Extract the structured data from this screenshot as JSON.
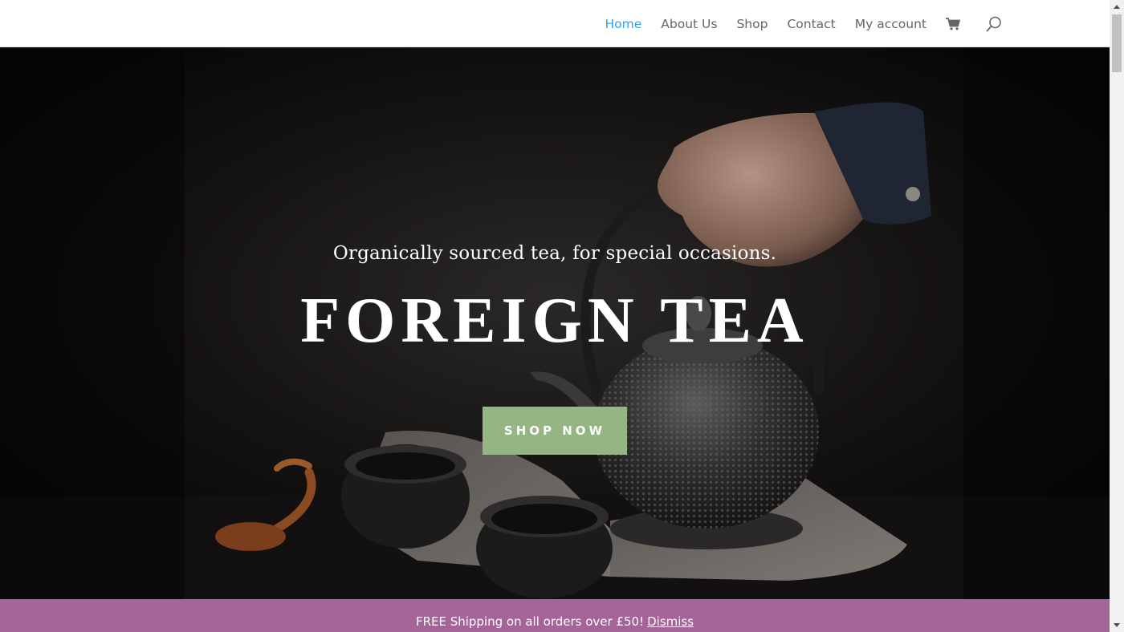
{
  "nav": {
    "items": [
      {
        "label": "Home",
        "active": true
      },
      {
        "label": "About Us",
        "active": false
      },
      {
        "label": "Shop",
        "active": false
      },
      {
        "label": "Contact",
        "active": false
      },
      {
        "label": "My account",
        "active": false
      }
    ],
    "cart_icon": "shopping-cart-icon",
    "search_icon": "search-icon"
  },
  "hero": {
    "subtitle": "Organically sourced tea, for special occasions.",
    "title": "FOREIGN TEA",
    "cta_label": "SHOP NOW"
  },
  "notice": {
    "text": "FREE Shipping on all orders over £50!",
    "dismiss_label": "Dismiss"
  },
  "colors": {
    "nav_active": "#2ea3f2",
    "nav_text": "#666666",
    "cta_background": "#96b585",
    "notice_background": "#a46497",
    "hero_background": "#0d0b0b"
  }
}
